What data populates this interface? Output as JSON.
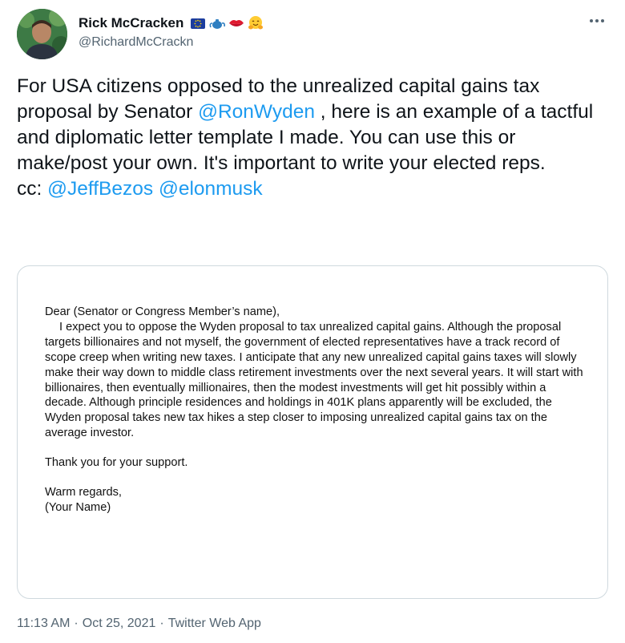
{
  "author": {
    "display_name": "Rick McCracken",
    "handle": "@RichardMcCrackn",
    "name_emojis": [
      "eu-flag-emoji",
      "teapot-emoji",
      "kiss-mark-emoji",
      "hugging-face-emoji"
    ]
  },
  "tweet": {
    "text_1": "For USA citizens opposed to the unrealized capital gains tax proposal by Senator ",
    "mention_1": "@RonWyden",
    "text_2": " , here is an example of a tactful and diplomatic letter template I made. You can use this or make/post your own. It's important to write your elected reps.\ncc: ",
    "mention_2": "@JeffBezos",
    "text_3": " ",
    "mention_3": "@elonmusk"
  },
  "letter": {
    "salutation": "Dear (Senator or Congress Member’s name),",
    "body": "I expect you to oppose the Wyden proposal to tax unrealized capital gains. Although the proposal targets billionaires and not myself, the government of elected representatives have a track record of scope creep when writing new taxes. I anticipate that any new unrealized capital gains taxes will slowly make their way down to middle class retirement investments over the next several years. It will start with billionaires, then eventually millionaires, then the modest investments will get hit possibly within a decade. Although principle residences and holdings in 401K plans apparently will be excluded, the Wyden proposal takes new tax hikes a step closer to imposing unrealized capital gains tax on the average investor.",
    "thanks": "Thank you for your support.",
    "closing": "Warm regards,",
    "signature": "(Your Name)"
  },
  "meta": {
    "time": "11:13 AM",
    "sep1": "·",
    "date": "Oct 25, 2021",
    "sep2": "·",
    "app": "Twitter Web App"
  },
  "colors": {
    "link": "#1d9bf0",
    "text": "#0f1419",
    "secondary": "#536471",
    "border": "#cfd9de"
  }
}
